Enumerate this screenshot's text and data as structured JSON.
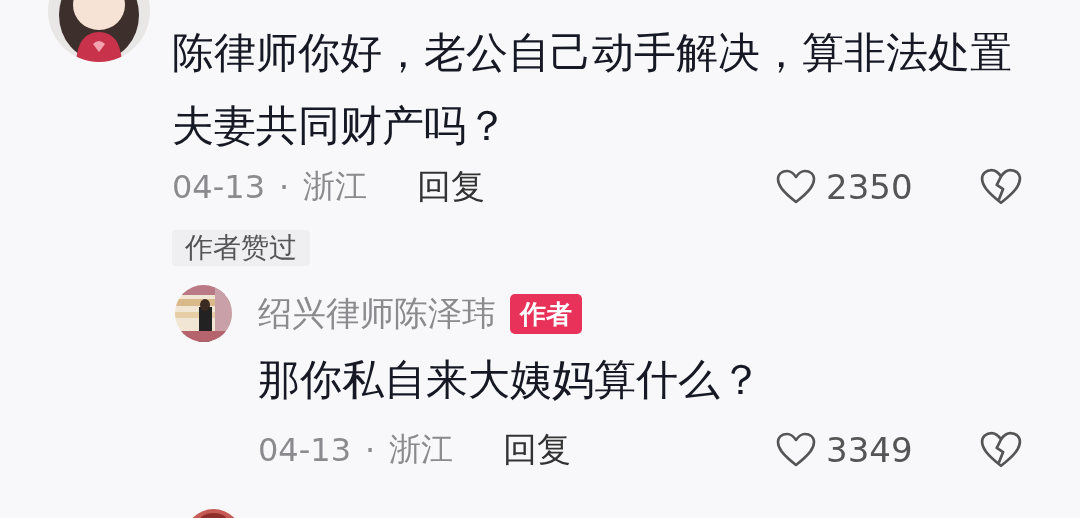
{
  "comments": [
    {
      "avatar": {
        "kind": "picture"
      },
      "text": "陈律师你好，老公自己动手解决，算非法处置夫妻共同财产吗？",
      "date": "04-13",
      "separator": "·",
      "region": "浙江",
      "reply_label": "回复",
      "likes": "2350",
      "liked": false,
      "badge": "作者赞过",
      "replies": [
        {
          "avatar": {
            "kind": "picture"
          },
          "author": "绍兴律师陈泽玮",
          "tag": "作者",
          "text": "那你私自来大姨妈算什么？",
          "date": "04-13",
          "separator": "·",
          "region": "浙江",
          "reply_label": "回复",
          "likes": "3349",
          "liked": false
        }
      ]
    },
    {
      "avatar": {
        "kind": "picture"
      }
    }
  ]
}
